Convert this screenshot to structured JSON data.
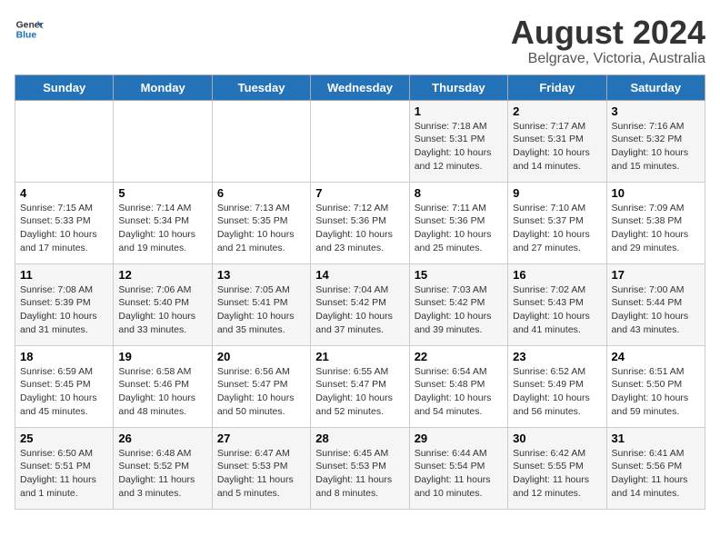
{
  "header": {
    "logo_general": "General",
    "logo_blue": "Blue",
    "main_title": "August 2024",
    "subtitle": "Belgrave, Victoria, Australia"
  },
  "days_of_week": [
    "Sunday",
    "Monday",
    "Tuesday",
    "Wednesday",
    "Thursday",
    "Friday",
    "Saturday"
  ],
  "weeks": [
    [
      {
        "day": "",
        "content": ""
      },
      {
        "day": "",
        "content": ""
      },
      {
        "day": "",
        "content": ""
      },
      {
        "day": "",
        "content": ""
      },
      {
        "day": "1",
        "content": "Sunrise: 7:18 AM\nSunset: 5:31 PM\nDaylight: 10 hours and 12 minutes."
      },
      {
        "day": "2",
        "content": "Sunrise: 7:17 AM\nSunset: 5:31 PM\nDaylight: 10 hours and 14 minutes."
      },
      {
        "day": "3",
        "content": "Sunrise: 7:16 AM\nSunset: 5:32 PM\nDaylight: 10 hours and 15 minutes."
      }
    ],
    [
      {
        "day": "4",
        "content": "Sunrise: 7:15 AM\nSunset: 5:33 PM\nDaylight: 10 hours and 17 minutes."
      },
      {
        "day": "5",
        "content": "Sunrise: 7:14 AM\nSunset: 5:34 PM\nDaylight: 10 hours and 19 minutes."
      },
      {
        "day": "6",
        "content": "Sunrise: 7:13 AM\nSunset: 5:35 PM\nDaylight: 10 hours and 21 minutes."
      },
      {
        "day": "7",
        "content": "Sunrise: 7:12 AM\nSunset: 5:36 PM\nDaylight: 10 hours and 23 minutes."
      },
      {
        "day": "8",
        "content": "Sunrise: 7:11 AM\nSunset: 5:36 PM\nDaylight: 10 hours and 25 minutes."
      },
      {
        "day": "9",
        "content": "Sunrise: 7:10 AM\nSunset: 5:37 PM\nDaylight: 10 hours and 27 minutes."
      },
      {
        "day": "10",
        "content": "Sunrise: 7:09 AM\nSunset: 5:38 PM\nDaylight: 10 hours and 29 minutes."
      }
    ],
    [
      {
        "day": "11",
        "content": "Sunrise: 7:08 AM\nSunset: 5:39 PM\nDaylight: 10 hours and 31 minutes."
      },
      {
        "day": "12",
        "content": "Sunrise: 7:06 AM\nSunset: 5:40 PM\nDaylight: 10 hours and 33 minutes."
      },
      {
        "day": "13",
        "content": "Sunrise: 7:05 AM\nSunset: 5:41 PM\nDaylight: 10 hours and 35 minutes."
      },
      {
        "day": "14",
        "content": "Sunrise: 7:04 AM\nSunset: 5:42 PM\nDaylight: 10 hours and 37 minutes."
      },
      {
        "day": "15",
        "content": "Sunrise: 7:03 AM\nSunset: 5:42 PM\nDaylight: 10 hours and 39 minutes."
      },
      {
        "day": "16",
        "content": "Sunrise: 7:02 AM\nSunset: 5:43 PM\nDaylight: 10 hours and 41 minutes."
      },
      {
        "day": "17",
        "content": "Sunrise: 7:00 AM\nSunset: 5:44 PM\nDaylight: 10 hours and 43 minutes."
      }
    ],
    [
      {
        "day": "18",
        "content": "Sunrise: 6:59 AM\nSunset: 5:45 PM\nDaylight: 10 hours and 45 minutes."
      },
      {
        "day": "19",
        "content": "Sunrise: 6:58 AM\nSunset: 5:46 PM\nDaylight: 10 hours and 48 minutes."
      },
      {
        "day": "20",
        "content": "Sunrise: 6:56 AM\nSunset: 5:47 PM\nDaylight: 10 hours and 50 minutes."
      },
      {
        "day": "21",
        "content": "Sunrise: 6:55 AM\nSunset: 5:47 PM\nDaylight: 10 hours and 52 minutes."
      },
      {
        "day": "22",
        "content": "Sunrise: 6:54 AM\nSunset: 5:48 PM\nDaylight: 10 hours and 54 minutes."
      },
      {
        "day": "23",
        "content": "Sunrise: 6:52 AM\nSunset: 5:49 PM\nDaylight: 10 hours and 56 minutes."
      },
      {
        "day": "24",
        "content": "Sunrise: 6:51 AM\nSunset: 5:50 PM\nDaylight: 10 hours and 59 minutes."
      }
    ],
    [
      {
        "day": "25",
        "content": "Sunrise: 6:50 AM\nSunset: 5:51 PM\nDaylight: 11 hours and 1 minute."
      },
      {
        "day": "26",
        "content": "Sunrise: 6:48 AM\nSunset: 5:52 PM\nDaylight: 11 hours and 3 minutes."
      },
      {
        "day": "27",
        "content": "Sunrise: 6:47 AM\nSunset: 5:53 PM\nDaylight: 11 hours and 5 minutes."
      },
      {
        "day": "28",
        "content": "Sunrise: 6:45 AM\nSunset: 5:53 PM\nDaylight: 11 hours and 8 minutes."
      },
      {
        "day": "29",
        "content": "Sunrise: 6:44 AM\nSunset: 5:54 PM\nDaylight: 11 hours and 10 minutes."
      },
      {
        "day": "30",
        "content": "Sunrise: 6:42 AM\nSunset: 5:55 PM\nDaylight: 11 hours and 12 minutes."
      },
      {
        "day": "31",
        "content": "Sunrise: 6:41 AM\nSunset: 5:56 PM\nDaylight: 11 hours and 14 minutes."
      }
    ]
  ]
}
